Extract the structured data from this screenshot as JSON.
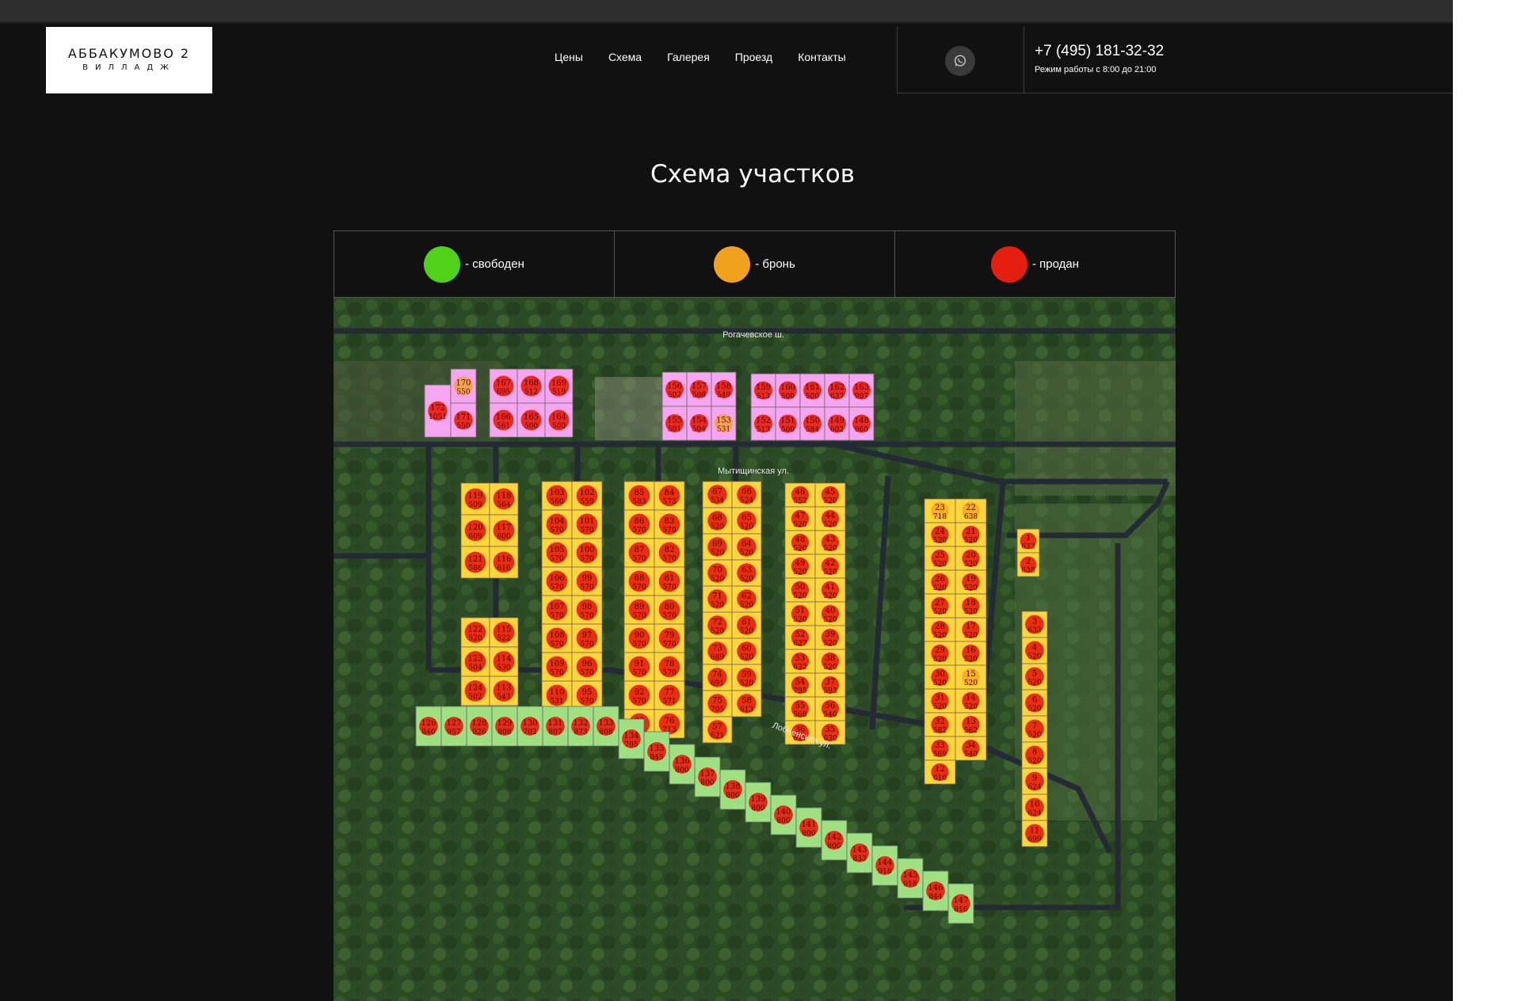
{
  "header": {
    "logo_line1": "АББАКУМОВО 2",
    "logo_line2": "ВИЛЛАДЖ",
    "nav": [
      "Цены",
      "Схема",
      "Галерея",
      "Проезд",
      "Контакты"
    ],
    "phone": "+7 (495) 181-32-32",
    "hours": "Режим работы с 8:00 до 21:00",
    "whatsapp_icon": "whatsapp-icon"
  },
  "page_title": "Схема участков",
  "legend": [
    {
      "label": "- свободен",
      "color": "#52d11a"
    },
    {
      "label": "- бронь",
      "color": "#f0a11d"
    },
    {
      "label": "- продан",
      "color": "#e51f10"
    }
  ],
  "map": {
    "streets": [
      "Рогачевское ш.",
      "Мытищинская ул.",
      "Лобненская ул."
    ],
    "plots": [
      {
        "n": "172",
        "a": "1051",
        "s": "sold",
        "g": "pink"
      },
      {
        "n": "170",
        "a": "550",
        "s": "reserved",
        "g": "pink"
      },
      {
        "n": "171",
        "a": "550",
        "s": "sold",
        "g": "pink"
      },
      {
        "n": "167",
        "a": "695",
        "s": "sold",
        "g": "pink"
      },
      {
        "n": "168",
        "a": "512",
        "s": "sold",
        "g": "pink"
      },
      {
        "n": "169",
        "a": "519",
        "s": "sold",
        "g": "pink"
      },
      {
        "n": "166",
        "a": "561",
        "s": "sold",
        "g": "pink"
      },
      {
        "n": "165",
        "a": "500",
        "s": "sold",
        "g": "pink"
      },
      {
        "n": "164",
        "a": "500",
        "s": "sold",
        "g": "pink"
      },
      {
        "n": "156",
        "a": "502",
        "s": "sold",
        "g": "pink"
      },
      {
        "n": "157",
        "a": "508",
        "s": "sold",
        "g": "pink"
      },
      {
        "n": "158",
        "a": "549",
        "s": "sold",
        "g": "pink"
      },
      {
        "n": "155",
        "a": "501",
        "s": "sold",
        "g": "pink"
      },
      {
        "n": "154",
        "a": "504",
        "s": "sold",
        "g": "pink"
      },
      {
        "n": "153",
        "a": "531",
        "s": "reserved",
        "g": "pink"
      },
      {
        "n": "159",
        "a": "513",
        "s": "sold",
        "g": "pink"
      },
      {
        "n": "160",
        "a": "500",
        "s": "sold",
        "g": "pink"
      },
      {
        "n": "161",
        "a": "500",
        "s": "sold",
        "g": "pink"
      },
      {
        "n": "162",
        "a": "637",
        "s": "sold",
        "g": "pink"
      },
      {
        "n": "163",
        "a": "907",
        "s": "sold",
        "g": "pink"
      },
      {
        "n": "152",
        "a": "513",
        "s": "sold",
        "g": "pink"
      },
      {
        "n": "151",
        "a": "500",
        "s": "sold",
        "g": "pink"
      },
      {
        "n": "150",
        "a": "584",
        "s": "sold",
        "g": "pink"
      },
      {
        "n": "149",
        "a": "602",
        "s": "sold",
        "g": "pink"
      },
      {
        "n": "148",
        "a": "960",
        "s": "sold",
        "g": "pink"
      },
      {
        "n": "119",
        "a": "509",
        "s": "sold",
        "g": "y1"
      },
      {
        "n": "118",
        "a": "564",
        "s": "sold",
        "g": "y1"
      },
      {
        "n": "120",
        "a": "609",
        "s": "sold",
        "g": "y1"
      },
      {
        "n": "117",
        "a": "600",
        "s": "sold",
        "g": "y1"
      },
      {
        "n": "121",
        "a": "586",
        "s": "sold",
        "g": "y1"
      },
      {
        "n": "116",
        "a": "616",
        "s": "sold",
        "g": "y1"
      },
      {
        "n": "122",
        "a": "520",
        "s": "sold",
        "g": "y2"
      },
      {
        "n": "115",
        "a": "522",
        "s": "sold",
        "g": "y2"
      },
      {
        "n": "123",
        "a": "504",
        "s": "sold",
        "g": "y2"
      },
      {
        "n": "114",
        "a": "530",
        "s": "sold",
        "g": "y2"
      },
      {
        "n": "124",
        "a": "502",
        "s": "sold",
        "g": "y2"
      },
      {
        "n": "113",
        "a": "543",
        "s": "sold",
        "g": "y2"
      },
      {
        "n": "125",
        "a": "603",
        "s": "sold",
        "g": "y2"
      },
      {
        "n": "112",
        "a": "614",
        "s": "sold",
        "g": "y2"
      },
      {
        "n": "103",
        "a": "560",
        "s": "sold",
        "g": "y3"
      },
      {
        "n": "102",
        "a": "559",
        "s": "sold",
        "g": "y3"
      },
      {
        "n": "104",
        "a": "570",
        "s": "sold",
        "g": "y3"
      },
      {
        "n": "101",
        "a": "570",
        "s": "sold",
        "g": "y3"
      },
      {
        "n": "105",
        "a": "570",
        "s": "sold",
        "g": "y3"
      },
      {
        "n": "100",
        "a": "570",
        "s": "sold",
        "g": "y3"
      },
      {
        "n": "106",
        "a": "570",
        "s": "sold",
        "g": "y3"
      },
      {
        "n": "99",
        "a": "570",
        "s": "sold",
        "g": "y3"
      },
      {
        "n": "107",
        "a": "570",
        "s": "sold",
        "g": "y3"
      },
      {
        "n": "98",
        "a": "570",
        "s": "sold",
        "g": "y3"
      },
      {
        "n": "108",
        "a": "570",
        "s": "sold",
        "g": "y3"
      },
      {
        "n": "97",
        "a": "570",
        "s": "sold",
        "g": "y3"
      },
      {
        "n": "109",
        "a": "570",
        "s": "sold",
        "g": "y3"
      },
      {
        "n": "96",
        "a": "570",
        "s": "sold",
        "g": "y3"
      },
      {
        "n": "110",
        "a": "531",
        "s": "sold",
        "g": "y3"
      },
      {
        "n": "95",
        "a": "570",
        "s": "sold",
        "g": "y3"
      },
      {
        "n": "111",
        "a": "527",
        "s": "sold",
        "g": "y3"
      },
      {
        "n": "94",
        "a": "518",
        "s": "sold",
        "g": "y3"
      },
      {
        "n": "85",
        "a": "583",
        "s": "sold",
        "g": "y4"
      },
      {
        "n": "84",
        "a": "573",
        "s": "sold",
        "g": "y4"
      },
      {
        "n": "86",
        "a": "570",
        "s": "sold",
        "g": "y4"
      },
      {
        "n": "83",
        "a": "570",
        "s": "sold",
        "g": "y4"
      },
      {
        "n": "87",
        "a": "570",
        "s": "sold",
        "g": "y4"
      },
      {
        "n": "82",
        "a": "570",
        "s": "sold",
        "g": "y4"
      },
      {
        "n": "88",
        "a": "570",
        "s": "sold",
        "g": "y4"
      },
      {
        "n": "81",
        "a": "570",
        "s": "sold",
        "g": "y4"
      },
      {
        "n": "89",
        "a": "570",
        "s": "sold",
        "g": "y4"
      },
      {
        "n": "80",
        "a": "570",
        "s": "sold",
        "g": "y4"
      },
      {
        "n": "90",
        "a": "570",
        "s": "sold",
        "g": "y4"
      },
      {
        "n": "79",
        "a": "570",
        "s": "sold",
        "g": "y4"
      },
      {
        "n": "91",
        "a": "570",
        "s": "sold",
        "g": "y4"
      },
      {
        "n": "78",
        "a": "570",
        "s": "sold",
        "g": "y4"
      },
      {
        "n": "92",
        "a": "570",
        "s": "sold",
        "g": "y4"
      },
      {
        "n": "77",
        "a": "571",
        "s": "sold",
        "g": "y4"
      },
      {
        "n": "93",
        "a": "521",
        "s": "sold",
        "g": "y4"
      },
      {
        "n": "76",
        "a": "713",
        "s": "sold",
        "g": "y4"
      },
      {
        "n": "67",
        "a": "534",
        "s": "sold",
        "g": "y5"
      },
      {
        "n": "66",
        "a": "524",
        "s": "sold",
        "g": "y5"
      },
      {
        "n": "68",
        "a": "520",
        "s": "sold",
        "g": "y5"
      },
      {
        "n": "65",
        "a": "520",
        "s": "sold",
        "g": "y5"
      },
      {
        "n": "69",
        "a": "520",
        "s": "sold",
        "g": "y5"
      },
      {
        "n": "64",
        "a": "520",
        "s": "sold",
        "g": "y5"
      },
      {
        "n": "70",
        "a": "520",
        "s": "sold",
        "g": "y5"
      },
      {
        "n": "63",
        "a": "520",
        "s": "sold",
        "g": "y5"
      },
      {
        "n": "71",
        "a": "520",
        "s": "sold",
        "g": "y5"
      },
      {
        "n": "62",
        "a": "520",
        "s": "sold",
        "g": "y5"
      },
      {
        "n": "72",
        "a": "520",
        "s": "sold",
        "g": "y5"
      },
      {
        "n": "61",
        "a": "520",
        "s": "sold",
        "g": "y5"
      },
      {
        "n": "73",
        "a": "689",
        "s": "sold",
        "g": "y5"
      },
      {
        "n": "60",
        "a": "520",
        "s": "sold",
        "g": "y5"
      },
      {
        "n": "74",
        "a": "691",
        "s": "sold",
        "g": "y5"
      },
      {
        "n": "59",
        "a": "520",
        "s": "sold",
        "g": "y5"
      },
      {
        "n": "75",
        "a": "705",
        "s": "sold",
        "g": "y5"
      },
      {
        "n": "58",
        "a": "613",
        "s": "sold",
        "g": "y5"
      },
      {
        "n": "57",
        "a": "621",
        "s": "sold",
        "g": "y5"
      },
      {
        "n": "46",
        "a": "552",
        "s": "sold",
        "g": "y6"
      },
      {
        "n": "45",
        "a": "520",
        "s": "sold",
        "g": "y6"
      },
      {
        "n": "47",
        "a": "520",
        "s": "sold",
        "g": "y6"
      },
      {
        "n": "44",
        "a": "520",
        "s": "sold",
        "g": "y6"
      },
      {
        "n": "48",
        "a": "520",
        "s": "sold",
        "g": "y6"
      },
      {
        "n": "43",
        "a": "520",
        "s": "sold",
        "g": "y6"
      },
      {
        "n": "49",
        "a": "520",
        "s": "sold",
        "g": "y6"
      },
      {
        "n": "42",
        "a": "520",
        "s": "sold",
        "g": "y6"
      },
      {
        "n": "50",
        "a": "520",
        "s": "sold",
        "g": "y6"
      },
      {
        "n": "41",
        "a": "520",
        "s": "sold",
        "g": "y6"
      },
      {
        "n": "51",
        "a": "520",
        "s": "sold",
        "g": "y6"
      },
      {
        "n": "40",
        "a": "520",
        "s": "sold",
        "g": "y6"
      },
      {
        "n": "52",
        "a": "627",
        "s": "sold",
        "g": "y6"
      },
      {
        "n": "39",
        "a": "520",
        "s": "sold",
        "g": "y6"
      },
      {
        "n": "53",
        "a": "632",
        "s": "sold",
        "g": "y6"
      },
      {
        "n": "38",
        "a": "520",
        "s": "sold",
        "g": "y6"
      },
      {
        "n": "54",
        "a": "795",
        "s": "sold",
        "g": "y6"
      },
      {
        "n": "37",
        "a": "593",
        "s": "sold",
        "g": "y6"
      },
      {
        "n": "55",
        "a": "568",
        "s": "sold",
        "g": "y6"
      },
      {
        "n": "56",
        "a": "540",
        "s": "sold",
        "g": "y6"
      },
      {
        "n": "36",
        "a": "611",
        "s": "sold",
        "g": "y6"
      },
      {
        "n": "35",
        "a": "630",
        "s": "sold",
        "g": "y6"
      },
      {
        "n": "23",
        "a": "718",
        "s": "reserved",
        "g": "y7"
      },
      {
        "n": "22",
        "a": "638",
        "s": "reserved",
        "g": "y7"
      },
      {
        "n": "24",
        "a": "520",
        "s": "sold",
        "g": "y7"
      },
      {
        "n": "21",
        "a": "520",
        "s": "sold",
        "g": "y7"
      },
      {
        "n": "25",
        "a": "520",
        "s": "sold",
        "g": "y7"
      },
      {
        "n": "20",
        "a": "520",
        "s": "sold",
        "g": "y7"
      },
      {
        "n": "26",
        "a": "520",
        "s": "sold",
        "g": "y7"
      },
      {
        "n": "19",
        "a": "520",
        "s": "sold",
        "g": "y7"
      },
      {
        "n": "27",
        "a": "520",
        "s": "sold",
        "g": "y7"
      },
      {
        "n": "18",
        "a": "520",
        "s": "sold",
        "g": "y7"
      },
      {
        "n": "28",
        "a": "520",
        "s": "sold",
        "g": "y7"
      },
      {
        "n": "17",
        "a": "520",
        "s": "sold",
        "g": "y7"
      },
      {
        "n": "29",
        "a": "520",
        "s": "sold",
        "g": "y7"
      },
      {
        "n": "16",
        "a": "520",
        "s": "sold",
        "g": "y7"
      },
      {
        "n": "30",
        "a": "520",
        "s": "sold",
        "g": "y7"
      },
      {
        "n": "15",
        "a": "520",
        "s": "reserved",
        "g": "y7"
      },
      {
        "n": "31",
        "a": "520",
        "s": "sold",
        "g": "y7"
      },
      {
        "n": "14",
        "a": "520",
        "s": "sold",
        "g": "y7"
      },
      {
        "n": "32",
        "a": "582",
        "s": "sold",
        "g": "y7"
      },
      {
        "n": "13",
        "a": "562",
        "s": "sold",
        "g": "y7"
      },
      {
        "n": "33",
        "a": "569",
        "s": "sold",
        "g": "y7"
      },
      {
        "n": "34",
        "a": "540",
        "s": "sold",
        "g": "y7"
      },
      {
        "n": "12",
        "a": "616",
        "s": "sold",
        "g": "y7"
      },
      {
        "n": "1",
        "a": "633",
        "s": "sold",
        "g": "y8"
      },
      {
        "n": "2",
        "a": "638",
        "s": "sold",
        "g": "y8"
      },
      {
        "n": "3",
        "a": "633",
        "s": "sold",
        "g": "y9"
      },
      {
        "n": "4",
        "a": "520",
        "s": "sold",
        "g": "y9"
      },
      {
        "n": "5",
        "a": "520",
        "s": "sold",
        "g": "y9"
      },
      {
        "n": "6",
        "a": "520",
        "s": "sold",
        "g": "y9"
      },
      {
        "n": "7",
        "a": "520",
        "s": "sold",
        "g": "y9"
      },
      {
        "n": "8",
        "a": "520",
        "s": "sold",
        "g": "y9"
      },
      {
        "n": "9",
        "a": "624",
        "s": "sold",
        "g": "y9"
      },
      {
        "n": "10",
        "a": "624",
        "s": "sold",
        "g": "y9"
      },
      {
        "n": "11",
        "a": "699",
        "s": "sold",
        "g": "y9"
      },
      {
        "n": "126",
        "a": "840",
        "s": "sold",
        "g": "green"
      },
      {
        "n": "127",
        "a": "957",
        "s": "sold",
        "g": "green"
      },
      {
        "n": "128",
        "a": "926",
        "s": "sold",
        "g": "green"
      },
      {
        "n": "129",
        "a": "808",
        "s": "sold",
        "g": "green"
      },
      {
        "n": "130",
        "a": "702",
        "s": "sold",
        "g": "green"
      },
      {
        "n": "131",
        "a": "807",
        "s": "sold",
        "g": "green"
      },
      {
        "n": "132",
        "a": "873",
        "s": "sold",
        "g": "green"
      },
      {
        "n": "133",
        "a": "808",
        "s": "sold",
        "g": "green"
      },
      {
        "n": "134",
        "a": "795",
        "s": "sold",
        "g": "green"
      },
      {
        "n": "135",
        "a": "845",
        "s": "sold",
        "g": "green"
      },
      {
        "n": "136",
        "a": "800",
        "s": "sold",
        "g": "green"
      },
      {
        "n": "137",
        "a": "800",
        "s": "sold",
        "g": "green"
      },
      {
        "n": "138",
        "a": "800",
        "s": "sold",
        "g": "green"
      },
      {
        "n": "139",
        "a": "800",
        "s": "sold",
        "g": "green"
      },
      {
        "n": "140",
        "a": "800",
        "s": "sold",
        "g": "green"
      },
      {
        "n": "141",
        "a": "800",
        "s": "sold",
        "g": "green"
      },
      {
        "n": "142",
        "a": "800",
        "s": "sold",
        "g": "green"
      },
      {
        "n": "143",
        "a": "833",
        "s": "sold",
        "g": "green"
      },
      {
        "n": "144",
        "a": "918",
        "s": "sold",
        "g": "green"
      },
      {
        "n": "145",
        "a": "918",
        "s": "sold",
        "g": "green"
      },
      {
        "n": "146",
        "a": "844",
        "s": "sold",
        "g": "green"
      },
      {
        "n": "147",
        "a": "816",
        "s": "sold",
        "g": "green"
      }
    ]
  }
}
